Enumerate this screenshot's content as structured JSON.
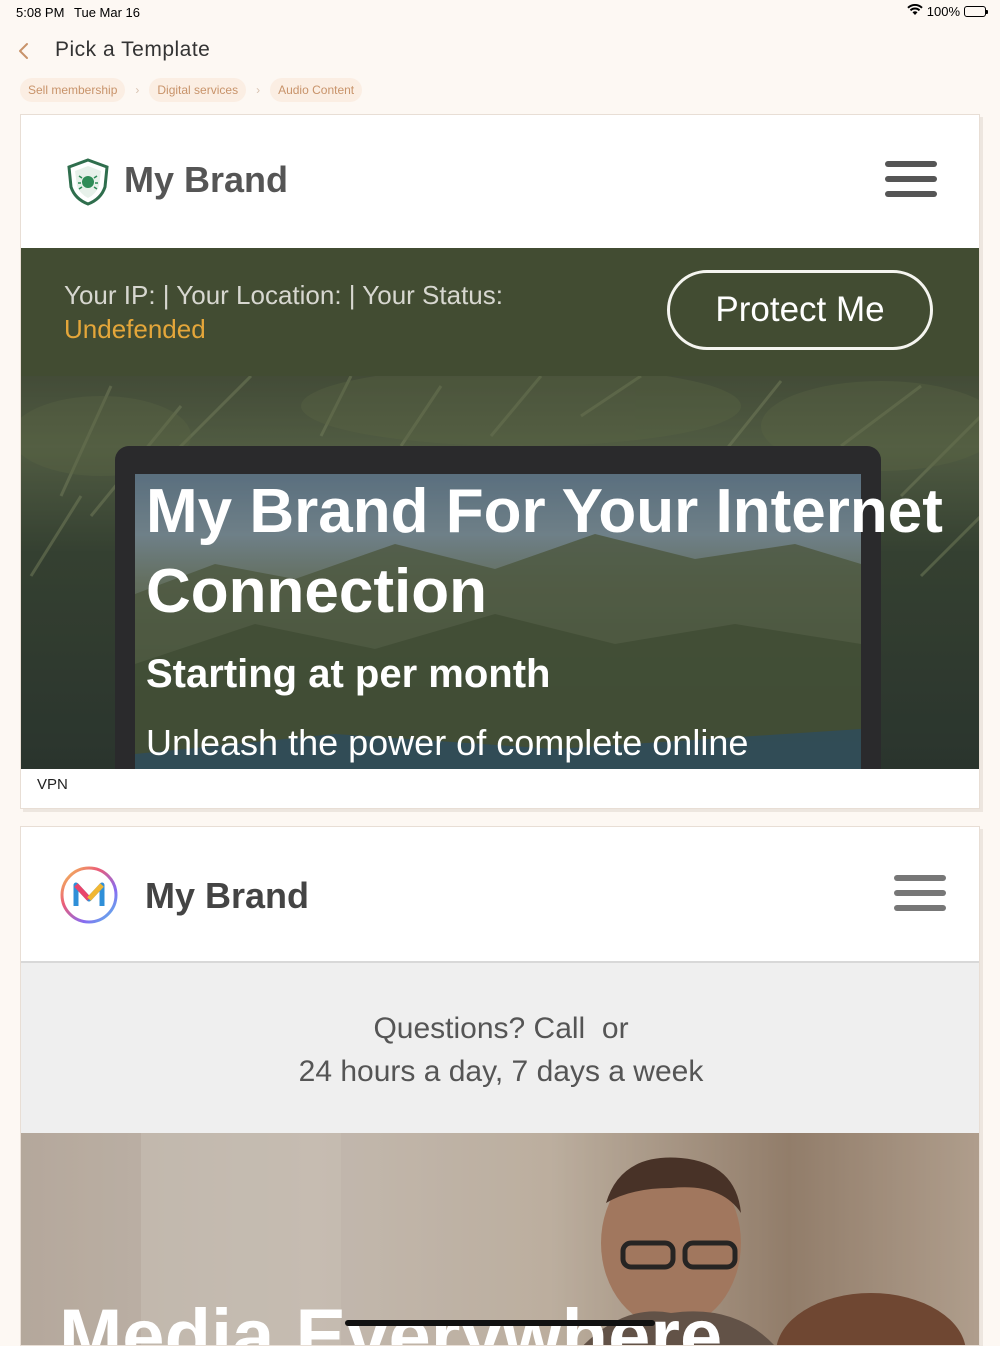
{
  "status_bar": {
    "time": "5:08 PM",
    "date": "Tue Mar 16",
    "battery": "100%",
    "icons": [
      "wifi-icon",
      "battery-icon"
    ]
  },
  "header": {
    "title": "Pick a Template",
    "back_icon": "chevron-left-icon"
  },
  "breadcrumb": [
    {
      "label": "Sell membership"
    },
    {
      "label": "Digital services"
    },
    {
      "label": "Audio Content"
    }
  ],
  "colors": {
    "accent": "#c8936a",
    "status_bg": "#424c32",
    "undefended": "#e4a63a"
  },
  "templates": [
    {
      "brand": "My Brand",
      "status_line": "Your IP: | Your Location: | Your Status:",
      "status_value": "Undefended",
      "cta": "Protect Me",
      "hero_title": "My Brand For Your Internet Connection",
      "hero_subtitle": "Starting at per month",
      "hero_text": "Unleash the power of complete online",
      "caption": "VPN"
    },
    {
      "brand": "My Brand",
      "info_line1": "Questions? Call  or",
      "info_line2": "24 hours a day, 7 days a week",
      "hero_title": "Media Everywhere"
    }
  ]
}
